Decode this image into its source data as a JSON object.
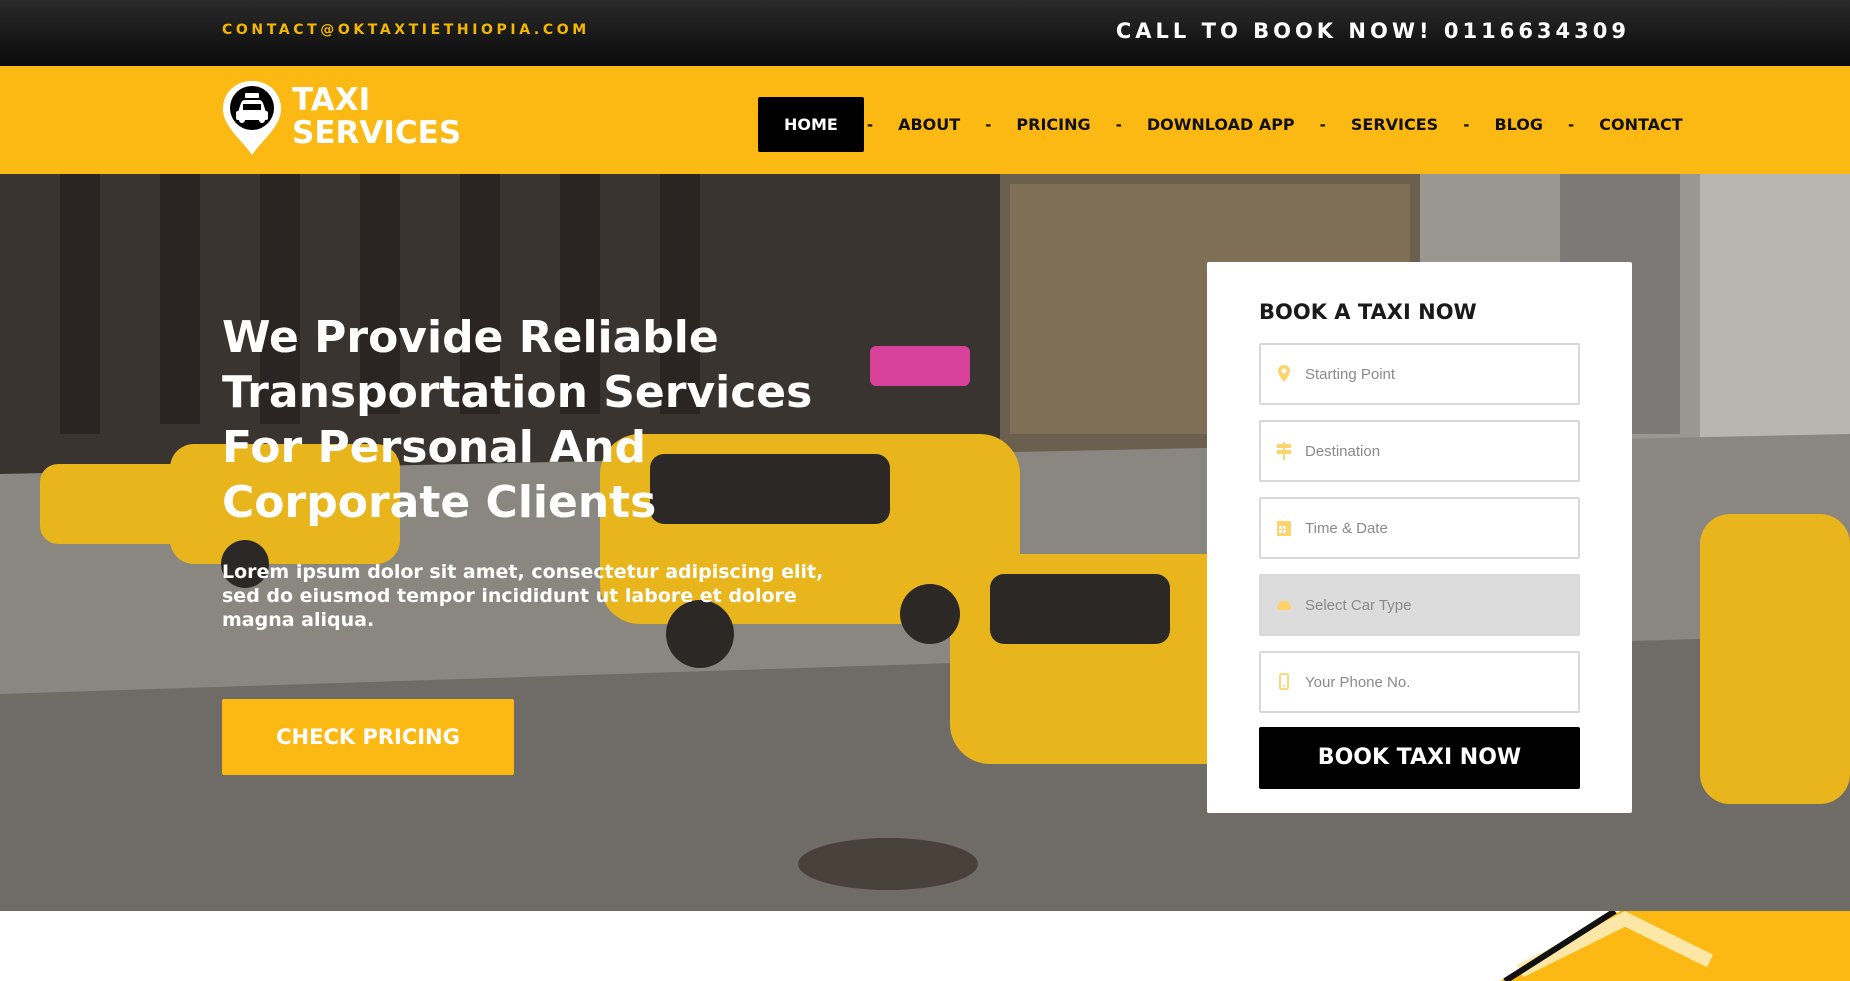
{
  "topbar": {
    "email": "CONTACT@OKTAXTIETHIOPIA.COM",
    "call": "CALL TO BOOK NOW! 0116634309"
  },
  "header": {
    "logo_line1": "TAXI",
    "logo_line2": "SERVICES",
    "nav": [
      {
        "label": "HOME",
        "active": true
      },
      {
        "label": "ABOUT"
      },
      {
        "label": "PRICING"
      },
      {
        "label": "DOWNLOAD APP"
      },
      {
        "label": "SERVICES"
      },
      {
        "label": "BLOG"
      },
      {
        "label": "CONTACT"
      }
    ],
    "separator": "-"
  },
  "hero": {
    "title_lines": [
      "We Provide Reliable",
      "Transportation Services",
      "For Personal And",
      "Corporate Clients"
    ],
    "subtitle": "Lorem ipsum dolor sit amet, consectetur adipiscing elit, sed do eiusmod tempor incididunt ut labore et dolore magna aliqua.",
    "cta": "CHECK PRICING"
  },
  "booking": {
    "title": "BOOK A TAXI NOW",
    "fields": [
      {
        "icon": "map-marker-icon",
        "placeholder": "Starting Point"
      },
      {
        "icon": "signpost-icon",
        "placeholder": "Destination"
      },
      {
        "icon": "calendar-icon",
        "placeholder": "Time & Date"
      },
      {
        "icon": "car-icon",
        "placeholder": "Select Car Type"
      },
      {
        "icon": "mobile-phone-icon",
        "placeholder": "Your Phone No."
      }
    ],
    "submit": "BOOK TAXI NOW"
  },
  "colors": {
    "brand_yellow": "#fdb913",
    "black": "#000000",
    "white": "#ffffff"
  }
}
